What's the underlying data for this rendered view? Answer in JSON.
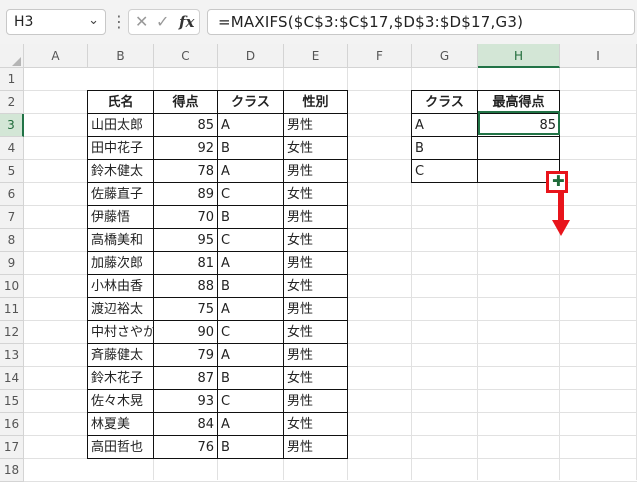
{
  "formula_bar": {
    "name_box": "H3",
    "name_box_dropdown": "⌄",
    "separator": "⋮",
    "cancel_glyph": "✕",
    "enter_glyph": "✓",
    "fx_label": "fx",
    "formula": "=MAXIFS($C$3:$C$17,$D$3:$D$17,G3)"
  },
  "columns": [
    "A",
    "B",
    "C",
    "D",
    "E",
    "F",
    "G",
    "H",
    "I"
  ],
  "rows": [
    "1",
    "2",
    "3",
    "4",
    "5",
    "6",
    "7",
    "8",
    "9",
    "10",
    "11",
    "12",
    "13",
    "14",
    "15",
    "16",
    "17",
    "18"
  ],
  "main_table": {
    "headers": [
      "氏名",
      "得点",
      "クラス",
      "性別"
    ],
    "rows": [
      [
        "山田太郎",
        "85",
        "A",
        "男性"
      ],
      [
        "田中花子",
        "92",
        "B",
        "女性"
      ],
      [
        "鈴木健太",
        "78",
        "A",
        "男性"
      ],
      [
        "佐藤直子",
        "89",
        "C",
        "女性"
      ],
      [
        "伊藤悟",
        "70",
        "B",
        "男性"
      ],
      [
        "高橋美和",
        "95",
        "C",
        "女性"
      ],
      [
        "加藤次郎",
        "81",
        "A",
        "男性"
      ],
      [
        "小林由香",
        "88",
        "B",
        "女性"
      ],
      [
        "渡辺裕太",
        "75",
        "A",
        "男性"
      ],
      [
        "中村さやか",
        "90",
        "C",
        "女性"
      ],
      [
        "斉藤健太",
        "79",
        "A",
        "男性"
      ],
      [
        "鈴木花子",
        "87",
        "B",
        "女性"
      ],
      [
        "佐々木晃",
        "93",
        "C",
        "男性"
      ],
      [
        "林夏美",
        "84",
        "A",
        "女性"
      ],
      [
        "高田哲也",
        "76",
        "B",
        "男性"
      ]
    ]
  },
  "summary_table": {
    "headers": [
      "クラス",
      "最高得点"
    ],
    "rows": [
      [
        "A",
        "85"
      ],
      [
        "B",
        ""
      ],
      [
        "C",
        ""
      ]
    ]
  },
  "selection": {
    "cell": "H3"
  },
  "colors": {
    "accent": "#217346",
    "annotation": "#e8141b"
  }
}
